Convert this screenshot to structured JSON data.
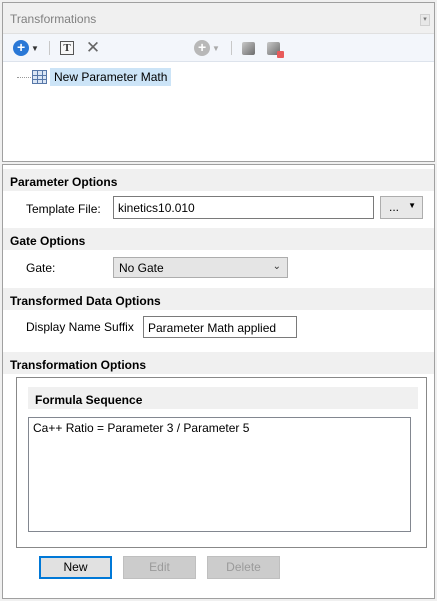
{
  "window": {
    "title": "Transformations"
  },
  "toolbar": {
    "add_icon": "add-circle-icon",
    "text_icon": "text-icon",
    "delete_icon": "delete-x-icon",
    "add2_icon": "add-circle-icon",
    "copy_icon": "copy-icon",
    "paste_icon": "paste-icon"
  },
  "tree": {
    "items": [
      {
        "label": "New Parameter Math",
        "icon": "parameter-math-icon",
        "selected": true
      }
    ]
  },
  "parameter_options": {
    "heading": "Parameter Options",
    "template_label": "Template File:",
    "template_value": "kinetics10.010",
    "browse_label": "..."
  },
  "gate_options": {
    "heading": "Gate Options",
    "gate_label": "Gate:",
    "gate_value": "No Gate"
  },
  "transformed_options": {
    "heading": "Transformed Data Options",
    "suffix_label": "Display Name Suffix",
    "suffix_value": "Parameter Math applied"
  },
  "transformation_options": {
    "heading": "Transformation Options",
    "sequence_heading": "Formula Sequence",
    "formulas": [
      "Ca++ Ratio = Parameter 3 / Parameter 5"
    ]
  },
  "actions": {
    "new": "New",
    "edit": "Edit",
    "delete": "Delete"
  },
  "colors": {
    "accent": "#0078d7",
    "selection": "#cce4f7",
    "add_icon": "#2a78d6"
  }
}
